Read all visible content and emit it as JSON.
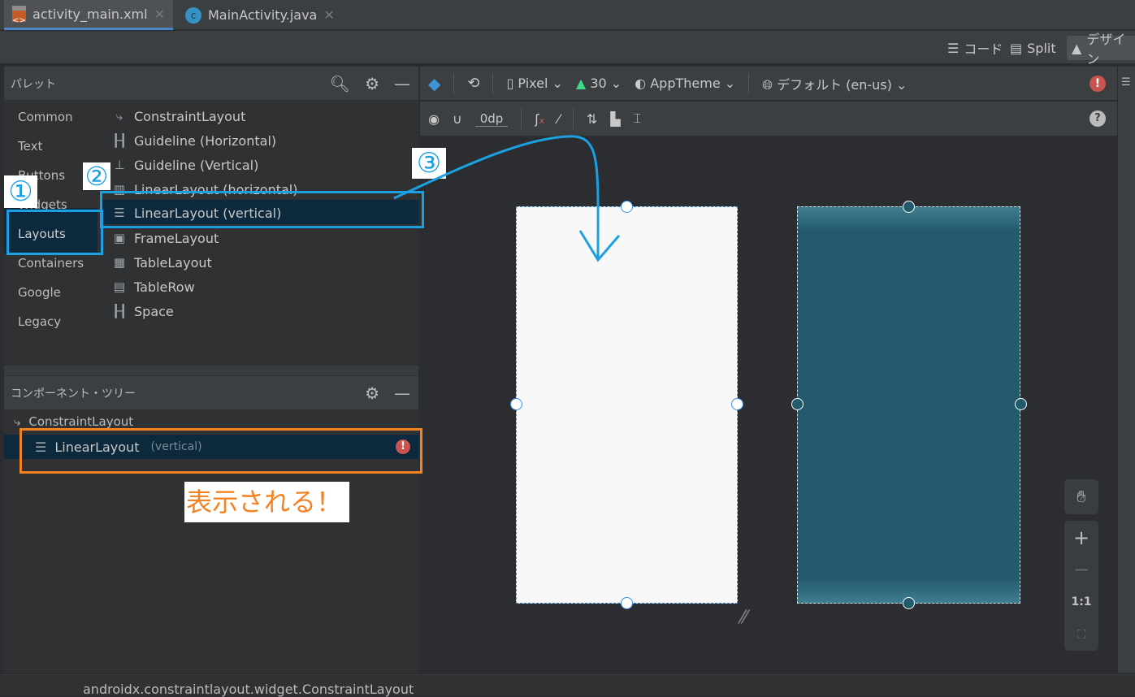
{
  "tabs": [
    {
      "label": "activity_main.xml",
      "active": true,
      "icon": "xml-file-icon"
    },
    {
      "label": "MainActivity.java",
      "active": false,
      "icon": "java-class-icon"
    }
  ],
  "view_modes": {
    "code": "コード",
    "split": "Split",
    "design": "デザイン"
  },
  "palette": {
    "title": "パレット",
    "categories": [
      "Common",
      "Text",
      "Buttons",
      "Widgets",
      "Layouts",
      "Containers",
      "Google",
      "Legacy"
    ],
    "selected_category": "Layouts",
    "items": [
      "ConstraintLayout",
      "Guideline (Horizontal)",
      "Guideline (Vertical)",
      "LinearLayout (horizontal)",
      "LinearLayout (vertical)",
      "FrameLayout",
      "TableLayout",
      "TableRow",
      "Space"
    ],
    "selected_item": "LinearLayout (vertical)"
  },
  "toolbar": {
    "device": "Pixel",
    "api": "30",
    "theme": "AppTheme",
    "locale": "デフォルト (en-us)",
    "margin": "0dp"
  },
  "component_tree": {
    "title": "コンポーネント・ツリー",
    "root": "ConstraintLayout",
    "child": {
      "name": "LinearLayout",
      "detail": "(vertical)",
      "has_error": true
    }
  },
  "zoom_controls": {
    "one_to_one": "1:1"
  },
  "status_bar": {
    "text": "androidx.constraintlayout.widget.ConstraintLayout"
  },
  "annotations": {
    "step1": "①",
    "step2": "②",
    "step3": "③",
    "note": "表示される！"
  },
  "colors": {
    "accent": "#4a88c7",
    "annotation_blue": "#1ba1e2",
    "annotation_orange": "#f58220",
    "blueprint": "#235b6c",
    "error": "#c75450"
  }
}
